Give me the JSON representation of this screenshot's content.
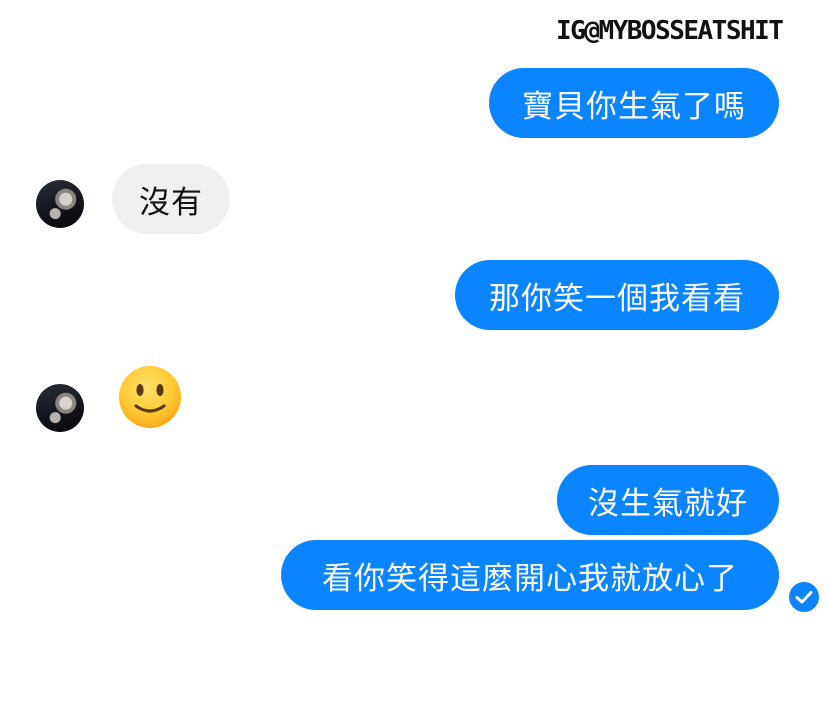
{
  "watermark": "IG@MYBOSSEATSHIT",
  "messages": [
    {
      "sender": "me",
      "text": "寶貝你生氣了嗎"
    },
    {
      "sender": "them",
      "text": "沒有"
    },
    {
      "sender": "me",
      "text": "那你笑一個我看看"
    },
    {
      "sender": "them",
      "emoji": "slightly-smiling-face"
    },
    {
      "sender": "me",
      "text": "沒生氣就好"
    },
    {
      "sender": "me",
      "text": "看你笑得這麼開心我就放心了"
    }
  ],
  "status": {
    "icon": "seen-check-icon"
  },
  "colors": {
    "outgoing_bubble": "#0a84ff",
    "incoming_bubble": "#f1f0f0",
    "seen_icon": "#0a84ff"
  }
}
